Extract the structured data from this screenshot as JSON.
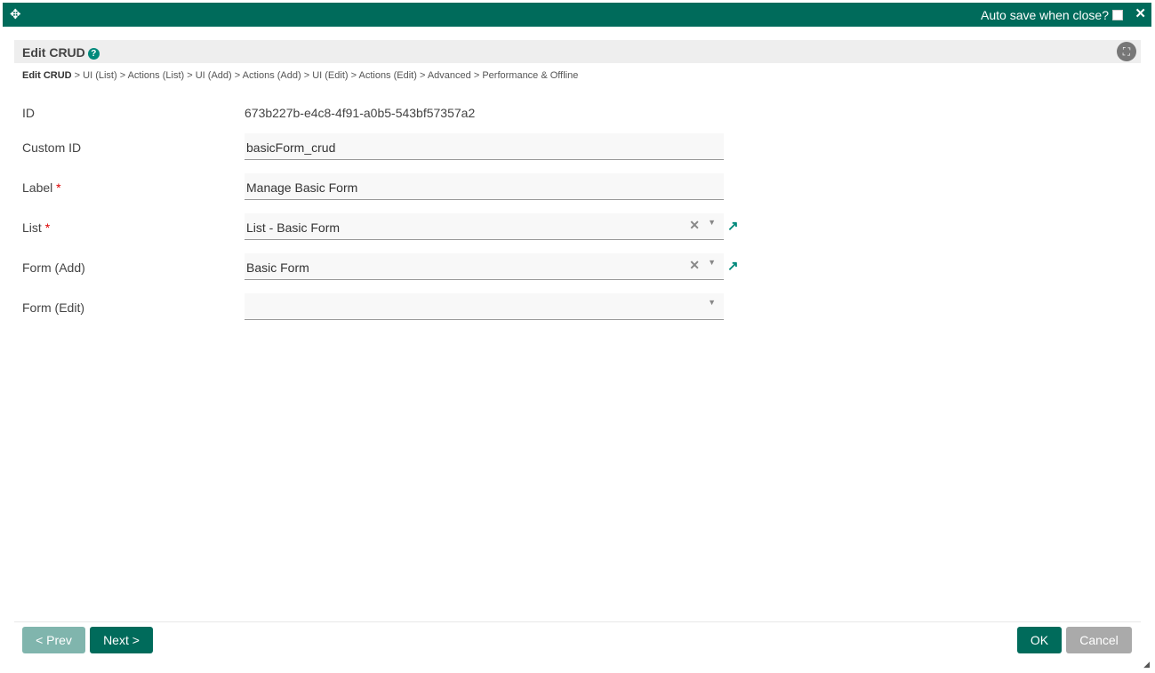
{
  "window": {
    "autosave_label": "Auto save when close?",
    "move_icon": "✥",
    "close_icon": "✕"
  },
  "header": {
    "title": "Edit CRUD",
    "help_icon": "?",
    "fullscreen_icon": "⛶"
  },
  "breadcrumb": {
    "current": "Edit CRUD",
    "items": [
      "UI (List)",
      "Actions (List)",
      "UI (Add)",
      "Actions (Add)",
      "UI (Edit)",
      "Actions (Edit)",
      "Advanced",
      "Performance & Offline"
    ]
  },
  "fields": {
    "id_label": "ID",
    "id_value": "673b227b-e4c8-4f91-a0b5-543bf57357a2",
    "custom_id_label": "Custom ID",
    "custom_id_value": "basicForm_crud",
    "label_label": "Label",
    "label_value": "Manage Basic Form",
    "list_label": "List",
    "list_value": "List - Basic Form",
    "form_add_label": "Form (Add)",
    "form_add_value": "Basic Form",
    "form_edit_label": "Form (Edit)",
    "form_edit_value": ""
  },
  "footer": {
    "prev": "< Prev",
    "next": "Next >",
    "ok": "OK",
    "cancel": "Cancel"
  },
  "colors": {
    "primary": "#006b5b",
    "accent": "#00897b"
  }
}
